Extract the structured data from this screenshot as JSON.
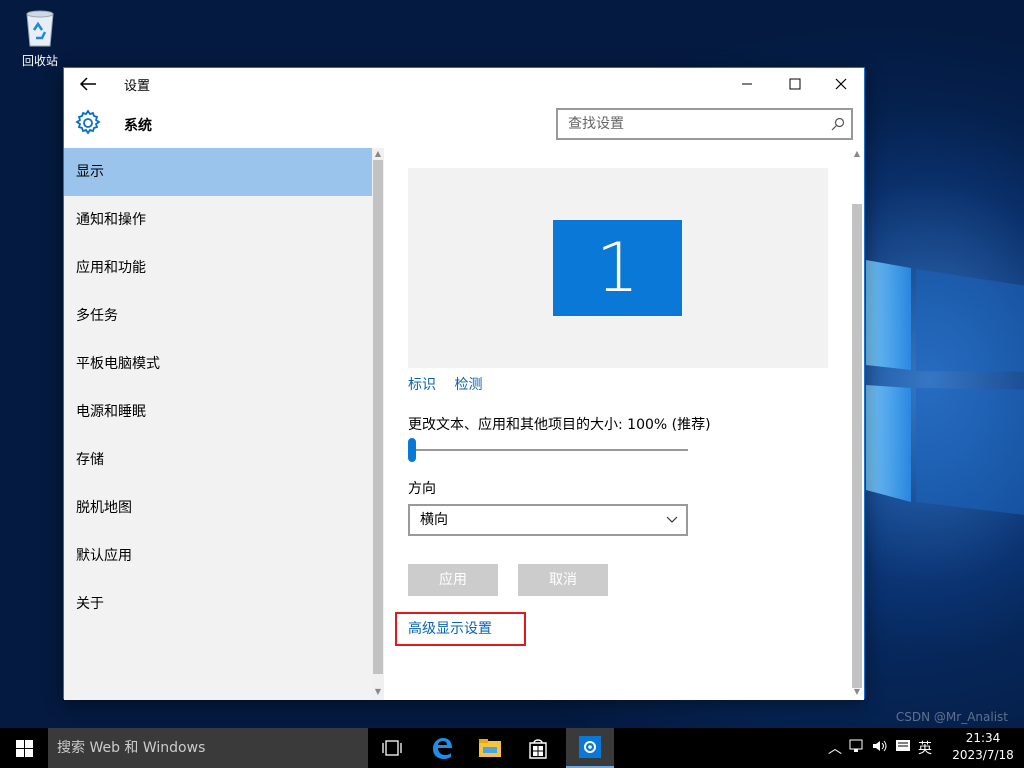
{
  "desktop": {
    "recycle_bin_label": "回收站",
    "watermark": "CSDN @Mr_Analist"
  },
  "window": {
    "title": "设置",
    "section_title": "系统",
    "search_placeholder": "查找设置"
  },
  "sidebar": {
    "items": [
      {
        "label": "显示",
        "active": true
      },
      {
        "label": "通知和操作"
      },
      {
        "label": "应用和功能"
      },
      {
        "label": "多任务"
      },
      {
        "label": "平板电脑模式"
      },
      {
        "label": "电源和睡眠"
      },
      {
        "label": "存储"
      },
      {
        "label": "脱机地图"
      },
      {
        "label": "默认应用"
      },
      {
        "label": "关于"
      }
    ]
  },
  "content": {
    "monitor_number": "1",
    "identify_link": "标识",
    "detect_link": "检测",
    "scale_label": "更改文本、应用和其他项目的大小: 100% (推荐)",
    "scale_slider_fraction": 0.0,
    "orientation_label": "方向",
    "orientation_value": "横向",
    "apply_button": "应用",
    "cancel_button": "取消",
    "advanced_link": "高级显示设置"
  },
  "taskbar": {
    "search_placeholder": "搜索 Web 和 Windows",
    "ime": "英",
    "time": "21:34",
    "date": "2023/7/18",
    "accent": "#0a78d7"
  }
}
